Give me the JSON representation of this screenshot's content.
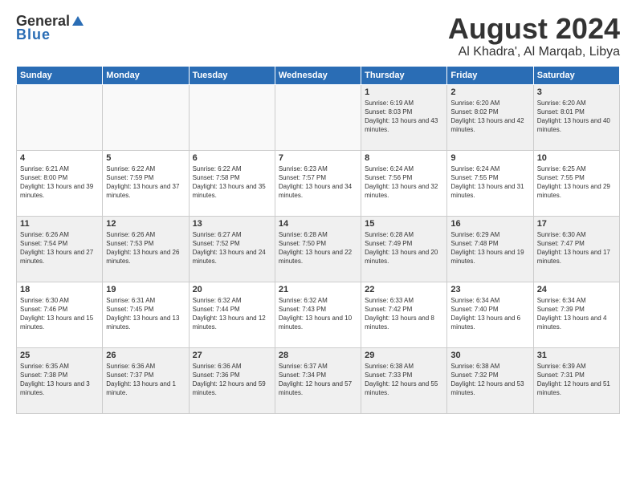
{
  "header": {
    "logo": {
      "general": "General",
      "blue": "Blue"
    },
    "title": "August 2024",
    "location": "Al Khadra', Al Marqab, Libya"
  },
  "weekdays": [
    "Sunday",
    "Monday",
    "Tuesday",
    "Wednesday",
    "Thursday",
    "Friday",
    "Saturday"
  ],
  "weeks": [
    [
      {
        "day": "",
        "empty": true
      },
      {
        "day": "",
        "empty": true
      },
      {
        "day": "",
        "empty": true
      },
      {
        "day": "",
        "empty": true
      },
      {
        "day": "1",
        "sunrise": "6:19 AM",
        "sunset": "8:03 PM",
        "daylight": "13 hours and 43 minutes."
      },
      {
        "day": "2",
        "sunrise": "6:20 AM",
        "sunset": "8:02 PM",
        "daylight": "13 hours and 42 minutes."
      },
      {
        "day": "3",
        "sunrise": "6:20 AM",
        "sunset": "8:01 PM",
        "daylight": "13 hours and 40 minutes."
      }
    ],
    [
      {
        "day": "4",
        "sunrise": "6:21 AM",
        "sunset": "8:00 PM",
        "daylight": "13 hours and 39 minutes."
      },
      {
        "day": "5",
        "sunrise": "6:22 AM",
        "sunset": "7:59 PM",
        "daylight": "13 hours and 37 minutes."
      },
      {
        "day": "6",
        "sunrise": "6:22 AM",
        "sunset": "7:58 PM",
        "daylight": "13 hours and 35 minutes."
      },
      {
        "day": "7",
        "sunrise": "6:23 AM",
        "sunset": "7:57 PM",
        "daylight": "13 hours and 34 minutes."
      },
      {
        "day": "8",
        "sunrise": "6:24 AM",
        "sunset": "7:56 PM",
        "daylight": "13 hours and 32 minutes."
      },
      {
        "day": "9",
        "sunrise": "6:24 AM",
        "sunset": "7:55 PM",
        "daylight": "13 hours and 31 minutes."
      },
      {
        "day": "10",
        "sunrise": "6:25 AM",
        "sunset": "7:55 PM",
        "daylight": "13 hours and 29 minutes."
      }
    ],
    [
      {
        "day": "11",
        "sunrise": "6:26 AM",
        "sunset": "7:54 PM",
        "daylight": "13 hours and 27 minutes."
      },
      {
        "day": "12",
        "sunrise": "6:26 AM",
        "sunset": "7:53 PM",
        "daylight": "13 hours and 26 minutes."
      },
      {
        "day": "13",
        "sunrise": "6:27 AM",
        "sunset": "7:52 PM",
        "daylight": "13 hours and 24 minutes."
      },
      {
        "day": "14",
        "sunrise": "6:28 AM",
        "sunset": "7:50 PM",
        "daylight": "13 hours and 22 minutes."
      },
      {
        "day": "15",
        "sunrise": "6:28 AM",
        "sunset": "7:49 PM",
        "daylight": "13 hours and 20 minutes."
      },
      {
        "day": "16",
        "sunrise": "6:29 AM",
        "sunset": "7:48 PM",
        "daylight": "13 hours and 19 minutes."
      },
      {
        "day": "17",
        "sunrise": "6:30 AM",
        "sunset": "7:47 PM",
        "daylight": "13 hours and 17 minutes."
      }
    ],
    [
      {
        "day": "18",
        "sunrise": "6:30 AM",
        "sunset": "7:46 PM",
        "daylight": "13 hours and 15 minutes."
      },
      {
        "day": "19",
        "sunrise": "6:31 AM",
        "sunset": "7:45 PM",
        "daylight": "13 hours and 13 minutes."
      },
      {
        "day": "20",
        "sunrise": "6:32 AM",
        "sunset": "7:44 PM",
        "daylight": "13 hours and 12 minutes."
      },
      {
        "day": "21",
        "sunrise": "6:32 AM",
        "sunset": "7:43 PM",
        "daylight": "13 hours and 10 minutes."
      },
      {
        "day": "22",
        "sunrise": "6:33 AM",
        "sunset": "7:42 PM",
        "daylight": "13 hours and 8 minutes."
      },
      {
        "day": "23",
        "sunrise": "6:34 AM",
        "sunset": "7:40 PM",
        "daylight": "13 hours and 6 minutes."
      },
      {
        "day": "24",
        "sunrise": "6:34 AM",
        "sunset": "7:39 PM",
        "daylight": "13 hours and 4 minutes."
      }
    ],
    [
      {
        "day": "25",
        "sunrise": "6:35 AM",
        "sunset": "7:38 PM",
        "daylight": "13 hours and 3 minutes."
      },
      {
        "day": "26",
        "sunrise": "6:36 AM",
        "sunset": "7:37 PM",
        "daylight": "13 hours and 1 minute."
      },
      {
        "day": "27",
        "sunrise": "6:36 AM",
        "sunset": "7:36 PM",
        "daylight": "12 hours and 59 minutes."
      },
      {
        "day": "28",
        "sunrise": "6:37 AM",
        "sunset": "7:34 PM",
        "daylight": "12 hours and 57 minutes."
      },
      {
        "day": "29",
        "sunrise": "6:38 AM",
        "sunset": "7:33 PM",
        "daylight": "12 hours and 55 minutes."
      },
      {
        "day": "30",
        "sunrise": "6:38 AM",
        "sunset": "7:32 PM",
        "daylight": "12 hours and 53 minutes."
      },
      {
        "day": "31",
        "sunrise": "6:39 AM",
        "sunset": "7:31 PM",
        "daylight": "12 hours and 51 minutes."
      }
    ]
  ]
}
